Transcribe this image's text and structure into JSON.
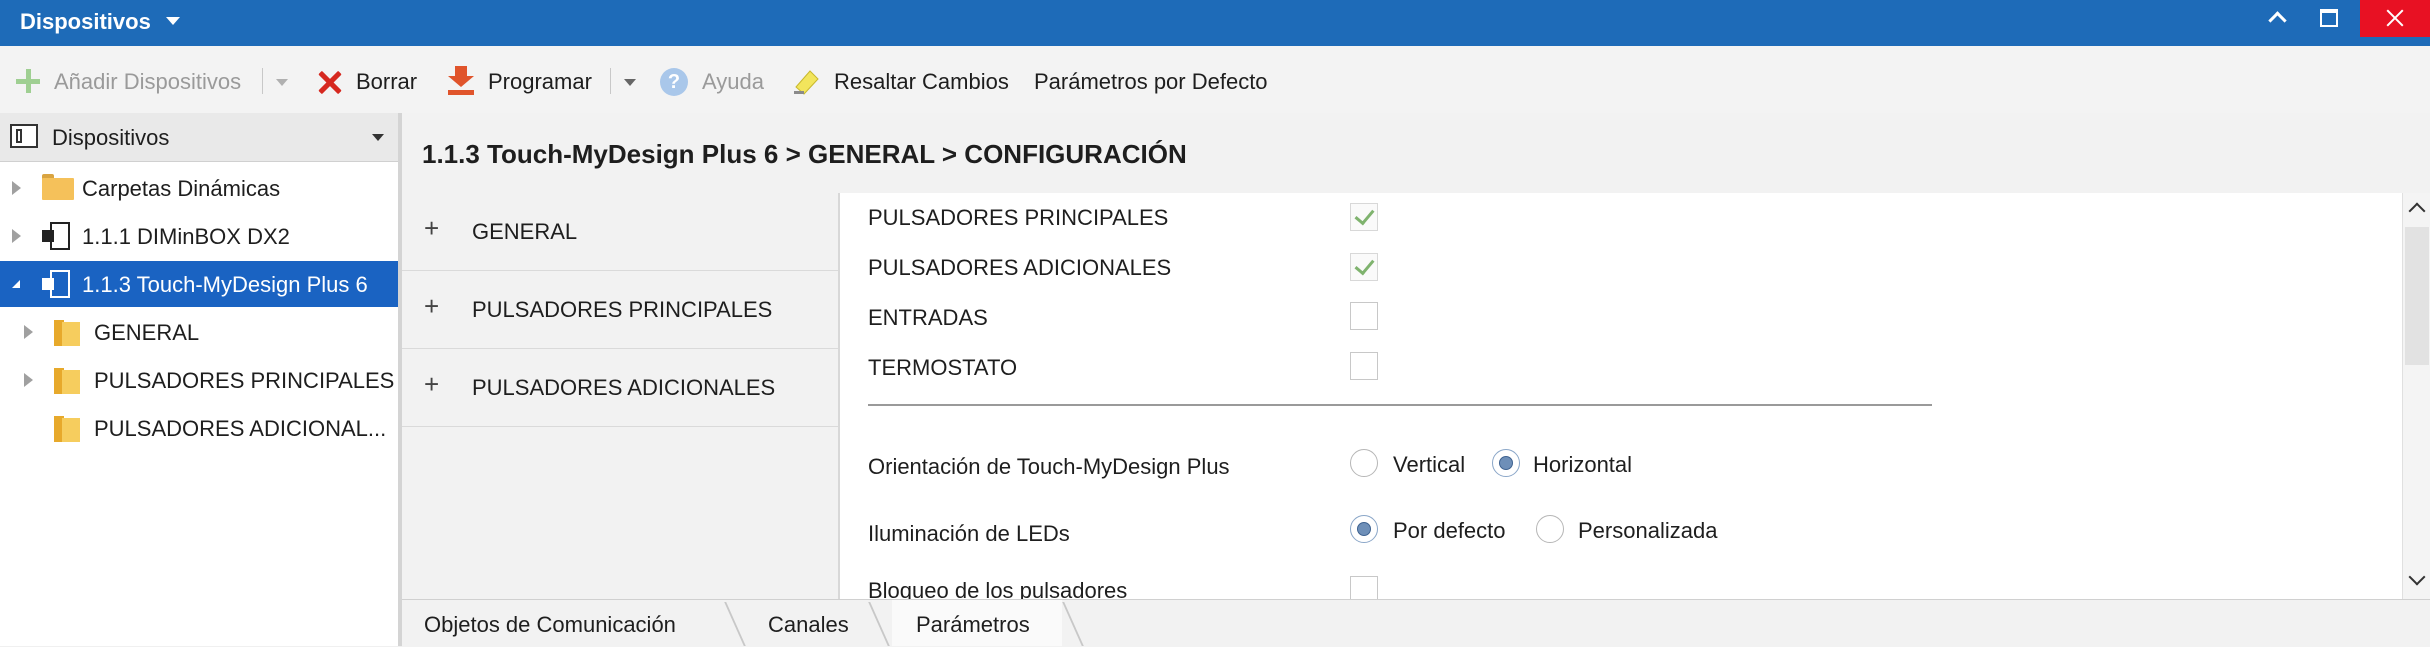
{
  "window": {
    "title": "Dispositivos"
  },
  "toolbar": {
    "add_devices": "Añadir Dispositivos",
    "delete": "Borrar",
    "program": "Programar",
    "help": "Ayuda",
    "highlight_changes": "Resaltar Cambios",
    "default_params": "Parámetros por Defecto"
  },
  "left_panel": {
    "header": "Dispositivos",
    "tree": [
      {
        "label": "Carpetas Dinámicas"
      },
      {
        "label": "1.1.1 DIMinBOX DX2"
      },
      {
        "label": "1.1.3 Touch-MyDesign Plus 6"
      },
      {
        "label": "GENERAL"
      },
      {
        "label": "PULSADORES PRINCIPALES"
      },
      {
        "label": "PULSADORES ADICIONAL..."
      }
    ]
  },
  "breadcrumb": "1.1.3 Touch-MyDesign Plus 6 > GENERAL > CONFIGURACIÓN",
  "sections": [
    {
      "label": "GENERAL"
    },
    {
      "label": "PULSADORES PRINCIPALES"
    },
    {
      "label": "PULSADORES ADICIONALES"
    }
  ],
  "params": {
    "checkboxes": [
      {
        "label": "PULSADORES PRINCIPALES",
        "checked": true
      },
      {
        "label": "PULSADORES ADICIONALES",
        "checked": true
      },
      {
        "label": "ENTRADAS",
        "checked": false
      },
      {
        "label": "TERMOSTATO",
        "checked": false
      }
    ],
    "orientation": {
      "label": "Orientación de Touch-MyDesign Plus",
      "options": [
        "Vertical",
        "Horizontal"
      ],
      "selected": "Horizontal"
    },
    "leds": {
      "label": "Iluminación de LEDs",
      "options": [
        "Por defecto",
        "Personalizada"
      ],
      "selected": "Por defecto"
    },
    "lock": {
      "label": "Bloqueo de los pulsadores"
    }
  },
  "tabs": [
    {
      "label": "Objetos de Comunicación"
    },
    {
      "label": "Canales"
    },
    {
      "label": "Parámetros",
      "active": true
    }
  ],
  "colors": {
    "titlebar": "#1e6bb8",
    "selection": "#1a63c2",
    "close": "#e81123"
  }
}
